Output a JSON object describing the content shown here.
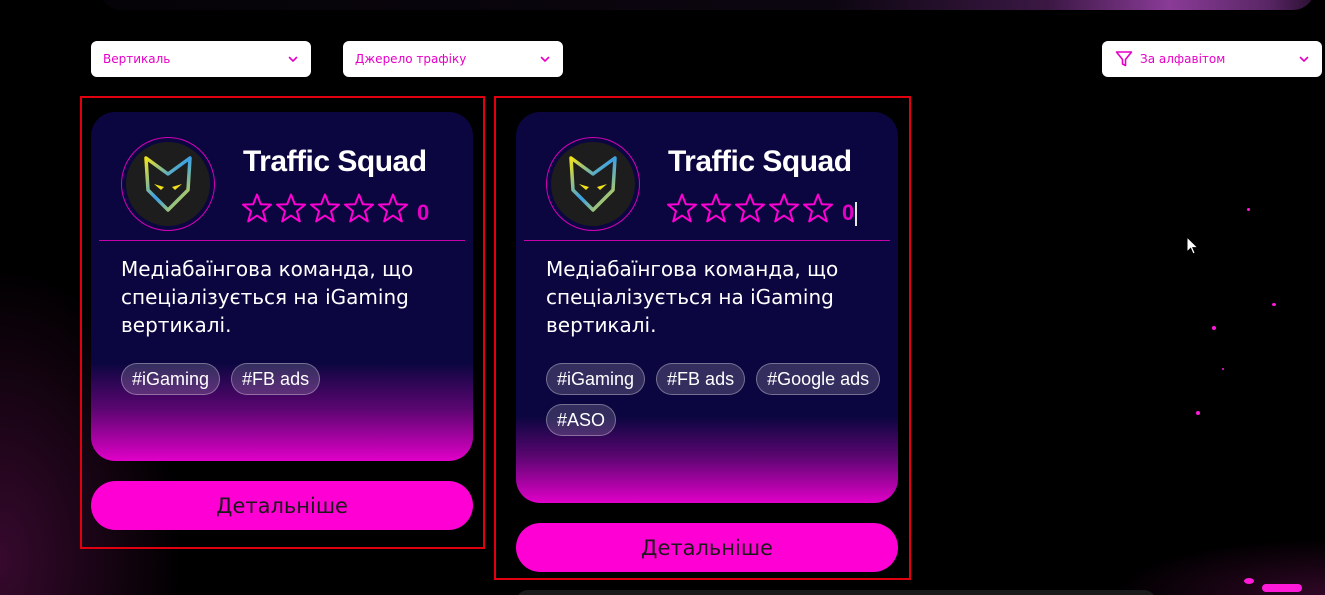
{
  "filters": {
    "vertical": {
      "label": "Вертикаль"
    },
    "traffic_source": {
      "label": "Джерело трафіку"
    },
    "sort": {
      "label": "За алфавітом"
    }
  },
  "cards": [
    {
      "title": "Traffic Squad",
      "rating": "0",
      "stars_total": 5,
      "stars_filled": 0,
      "description": "Медіабаїнгова команда, що спеціалізується на iGaming вертикалі.",
      "tags": [
        "#iGaming",
        "#FB ads"
      ],
      "button_label": "Детальніше"
    },
    {
      "title": "Traffic Squad",
      "rating": "0",
      "stars_total": 5,
      "stars_filled": 0,
      "description": "Медіабаїнгова команда, що спеціалізується на iGaming вертикалі.",
      "tags": [
        "#iGaming",
        "#FB ads",
        "#Google ads",
        "#ASO"
      ],
      "button_label": "Детальніше"
    }
  ],
  "colors": {
    "accent": "#ff00d4",
    "accent_text": "#e600c7",
    "card_bg": "#0b0640",
    "selection_border": "#e1000f"
  },
  "icons": {
    "dropdown": "chevron-down-icon",
    "sort": "filter-icon",
    "rating": "star-outline-icon",
    "logo": "fox-logo-icon"
  }
}
